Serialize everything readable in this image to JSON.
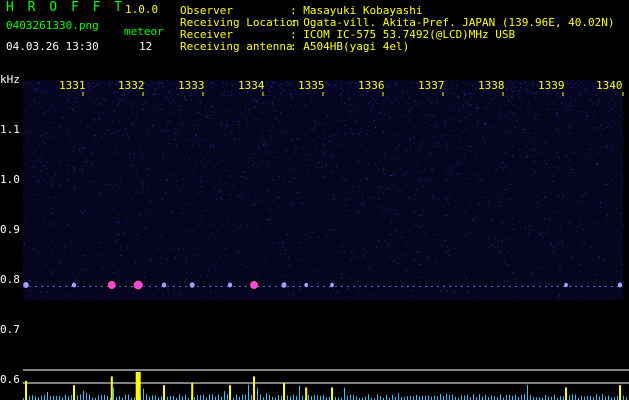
{
  "header": {
    "app_title": "H R O F F T",
    "version": "1.0.0",
    "filename": "0403261330.png",
    "meteor_label": "meteor",
    "datetime": "04.03.26 13:30",
    "meteor_count": "12"
  },
  "info": [
    {
      "key": "Observer",
      "value": ": Masayuki Kobayashi"
    },
    {
      "key": "Receiving Location",
      "value": ": Ogata-vill. Akita-Pref. JAPAN (139.96E, 40.02N)"
    },
    {
      "key": "Receiver",
      "value": ": ICOM IC-575 53.7492(@LCD)MHz USB"
    },
    {
      "key": "Receiving antenna",
      "value": ": A504HB(yagi 4el)"
    }
  ],
  "chart_data": {
    "type": "heatmap",
    "ylabel": "kHz",
    "y_ticks": [
      "1.1",
      "1.0",
      "0.9",
      "0.8",
      "0.7",
      "0.6"
    ],
    "x_ticks": [
      "1331",
      "1332",
      "1333",
      "1334",
      "1335",
      "1336",
      "1337",
      "1338",
      "1339",
      "1340"
    ],
    "y_range_khz": [
      0.6,
      1.2
    ],
    "x_range_min": [
      1330,
      1340
    ],
    "signal_band_khz": 0.79,
    "meteor_events": [
      {
        "time": 1330.05,
        "strength": 0.6
      },
      {
        "time": 1330.85,
        "strength": 0.4
      },
      {
        "time": 1331.48,
        "strength": 0.8
      },
      {
        "time": 1331.92,
        "strength": 1.0
      },
      {
        "time": 1332.35,
        "strength": 0.4
      },
      {
        "time": 1332.82,
        "strength": 0.5
      },
      {
        "time": 1333.45,
        "strength": 0.4
      },
      {
        "time": 1333.85,
        "strength": 0.8
      },
      {
        "time": 1334.35,
        "strength": 0.5
      },
      {
        "time": 1334.72,
        "strength": 0.3
      },
      {
        "time": 1335.15,
        "strength": 0.3
      },
      {
        "time": 1339.05,
        "strength": 0.3
      },
      {
        "time": 1339.95,
        "strength": 0.4
      }
    ],
    "colors": {
      "noise": "#1a1a7a",
      "meteor_core": "#ff40ff",
      "meteor_edge": "#ff6060",
      "trace_bar": "#ffff00",
      "trace_spike": "#40c0ff",
      "baseline": "#ffffff"
    }
  }
}
